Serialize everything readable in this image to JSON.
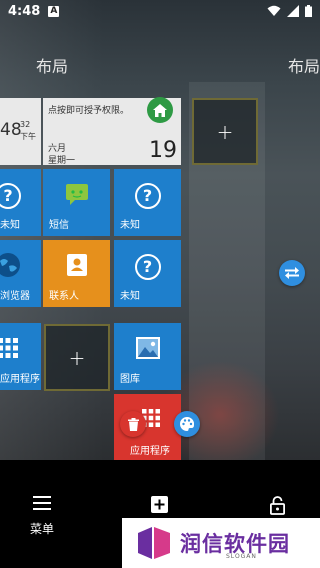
{
  "status_bar": {
    "time": "4:48",
    "notification_badge": "A"
  },
  "layout_labels": {
    "current": "布局",
    "next": "布局"
  },
  "tiles": {
    "clock": {
      "time": "48",
      "seconds": "32",
      "period": "下午"
    },
    "calendar": {
      "notice": "点按即可授予权限。",
      "month": "六月",
      "weekday": "星期一",
      "day": "19"
    },
    "unknown_label": "未知",
    "sms_label": "短信",
    "browser_label": "浏览器",
    "contacts_label": "联系人",
    "apps_label": "应用程序",
    "gallery_label": "图库"
  },
  "colors": {
    "tile_blue": "#1e7fcc",
    "tile_orange": "#e6901c",
    "tile_red": "#d8352e",
    "home_green": "#2e9a44",
    "fab_blue": "#2f8fe0"
  },
  "bottom_nav": {
    "menu_label": "菜单"
  },
  "watermark": {
    "brand": "润信软件园",
    "slogan": "SLOGAN"
  }
}
